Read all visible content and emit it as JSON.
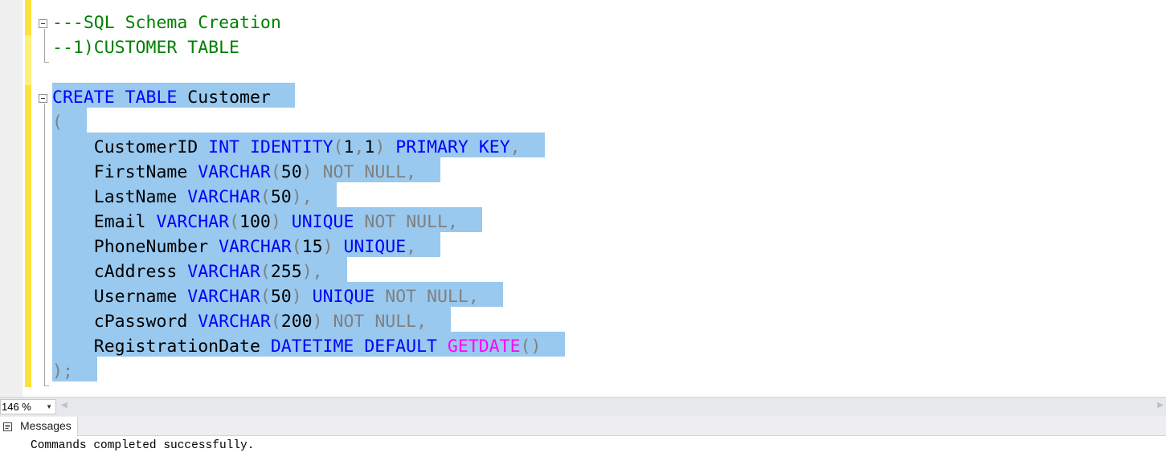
{
  "editor": {
    "lines": [
      [
        {
          "t": "---SQL Schema Creation",
          "c": "cmt"
        }
      ],
      [
        {
          "t": "--1)CUSTOMER TABLE",
          "c": "cmt"
        }
      ],
      [],
      [
        {
          "t": "CREATE",
          "c": "kw"
        },
        {
          "t": " ",
          "c": "txt"
        },
        {
          "t": "TABLE",
          "c": "kw"
        },
        {
          "t": " Customer",
          "c": "txt"
        }
      ],
      [
        {
          "t": "(",
          "c": "gray"
        }
      ],
      [
        {
          "t": "    CustomerID ",
          "c": "txt"
        },
        {
          "t": "INT",
          "c": "kw"
        },
        {
          "t": " ",
          "c": "txt"
        },
        {
          "t": "IDENTITY",
          "c": "kw"
        },
        {
          "t": "(",
          "c": "gray"
        },
        {
          "t": "1",
          "c": "txt"
        },
        {
          "t": ",",
          "c": "gray"
        },
        {
          "t": "1",
          "c": "txt"
        },
        {
          "t": ")",
          "c": "gray"
        },
        {
          "t": " ",
          "c": "txt"
        },
        {
          "t": "PRIMARY",
          "c": "kw"
        },
        {
          "t": " ",
          "c": "txt"
        },
        {
          "t": "KEY",
          "c": "kw"
        },
        {
          "t": ",",
          "c": "gray"
        }
      ],
      [
        {
          "t": "    FirstName ",
          "c": "txt"
        },
        {
          "t": "VARCHAR",
          "c": "kw"
        },
        {
          "t": "(",
          "c": "gray"
        },
        {
          "t": "50",
          "c": "txt"
        },
        {
          "t": ")",
          "c": "gray"
        },
        {
          "t": " ",
          "c": "txt"
        },
        {
          "t": "NOT",
          "c": "gray"
        },
        {
          "t": " ",
          "c": "txt"
        },
        {
          "t": "NULL",
          "c": "gray"
        },
        {
          "t": ",",
          "c": "gray"
        }
      ],
      [
        {
          "t": "    LastName ",
          "c": "txt"
        },
        {
          "t": "VARCHAR",
          "c": "kw"
        },
        {
          "t": "(",
          "c": "gray"
        },
        {
          "t": "50",
          "c": "txt"
        },
        {
          "t": ")",
          "c": "gray"
        },
        {
          "t": ",",
          "c": "gray"
        }
      ],
      [
        {
          "t": "    Email ",
          "c": "txt"
        },
        {
          "t": "VARCHAR",
          "c": "kw"
        },
        {
          "t": "(",
          "c": "gray"
        },
        {
          "t": "100",
          "c": "txt"
        },
        {
          "t": ")",
          "c": "gray"
        },
        {
          "t": " ",
          "c": "txt"
        },
        {
          "t": "UNIQUE",
          "c": "kw"
        },
        {
          "t": " ",
          "c": "txt"
        },
        {
          "t": "NOT",
          "c": "gray"
        },
        {
          "t": " ",
          "c": "txt"
        },
        {
          "t": "NULL",
          "c": "gray"
        },
        {
          "t": ",",
          "c": "gray"
        }
      ],
      [
        {
          "t": "    PhoneNumber ",
          "c": "txt"
        },
        {
          "t": "VARCHAR",
          "c": "kw"
        },
        {
          "t": "(",
          "c": "gray"
        },
        {
          "t": "15",
          "c": "txt"
        },
        {
          "t": ")",
          "c": "gray"
        },
        {
          "t": " ",
          "c": "txt"
        },
        {
          "t": "UNIQUE",
          "c": "kw"
        },
        {
          "t": ",",
          "c": "gray"
        }
      ],
      [
        {
          "t": "    cAddress ",
          "c": "txt"
        },
        {
          "t": "VARCHAR",
          "c": "kw"
        },
        {
          "t": "(",
          "c": "gray"
        },
        {
          "t": "255",
          "c": "txt"
        },
        {
          "t": ")",
          "c": "gray"
        },
        {
          "t": ",",
          "c": "gray"
        }
      ],
      [
        {
          "t": "    Username ",
          "c": "txt"
        },
        {
          "t": "VARCHAR",
          "c": "kw"
        },
        {
          "t": "(",
          "c": "gray"
        },
        {
          "t": "50",
          "c": "txt"
        },
        {
          "t": ")",
          "c": "gray"
        },
        {
          "t": " ",
          "c": "txt"
        },
        {
          "t": "UNIQUE",
          "c": "kw"
        },
        {
          "t": " ",
          "c": "txt"
        },
        {
          "t": "NOT",
          "c": "gray"
        },
        {
          "t": " ",
          "c": "txt"
        },
        {
          "t": "NULL",
          "c": "gray"
        },
        {
          "t": ",",
          "c": "gray"
        }
      ],
      [
        {
          "t": "    cPassword ",
          "c": "txt"
        },
        {
          "t": "VARCHAR",
          "c": "kw"
        },
        {
          "t": "(",
          "c": "gray"
        },
        {
          "t": "200",
          "c": "txt"
        },
        {
          "t": ")",
          "c": "gray"
        },
        {
          "t": " ",
          "c": "txt"
        },
        {
          "t": "NOT",
          "c": "gray"
        },
        {
          "t": " ",
          "c": "txt"
        },
        {
          "t": "NULL",
          "c": "gray"
        },
        {
          "t": ",",
          "c": "gray"
        }
      ],
      [
        {
          "t": "    RegistrationDate ",
          "c": "txt"
        },
        {
          "t": "DATETIME",
          "c": "kw"
        },
        {
          "t": " ",
          "c": "txt"
        },
        {
          "t": "DEFAULT",
          "c": "kw"
        },
        {
          "t": " ",
          "c": "txt"
        },
        {
          "t": "GETDATE",
          "c": "fn"
        },
        {
          "t": "()",
          "c": "gray"
        }
      ],
      [
        {
          "t": ");",
          "c": "gray"
        }
      ]
    ]
  },
  "statusbar": {
    "zoom": "146 %"
  },
  "results": {
    "tab_label": "Messages",
    "message": "Commands completed successfully."
  },
  "colors": {
    "comment": "#008000",
    "keyword": "#0000ff",
    "operator": "#808080",
    "function": "#ff00ff",
    "selection": "#99c9ef",
    "change_bar": "#fff07a"
  }
}
